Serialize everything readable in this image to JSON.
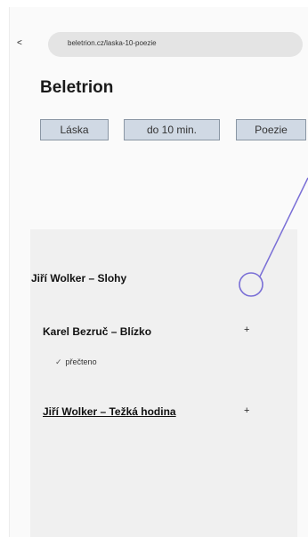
{
  "browser": {
    "back_icon": "<",
    "url": "beletrion.cz/laska-10-poezie"
  },
  "page": {
    "title": "Beletrion"
  },
  "tags": [
    "Láska",
    "do 10 min.",
    "Poezie"
  ],
  "list": {
    "items": [
      {
        "text": "Jiří Wolker – Slohy"
      },
      {
        "text": "Karel Bezruč – Blízko",
        "status": "přečteno",
        "action": "+"
      },
      {
        "text": "Jiří Wolker – Težká hodina",
        "action": "+"
      }
    ]
  },
  "colors": {
    "annotation": "#7a6fd6",
    "tag_bg": "#d0d9e4",
    "panel_bg": "#f0f0f0"
  }
}
